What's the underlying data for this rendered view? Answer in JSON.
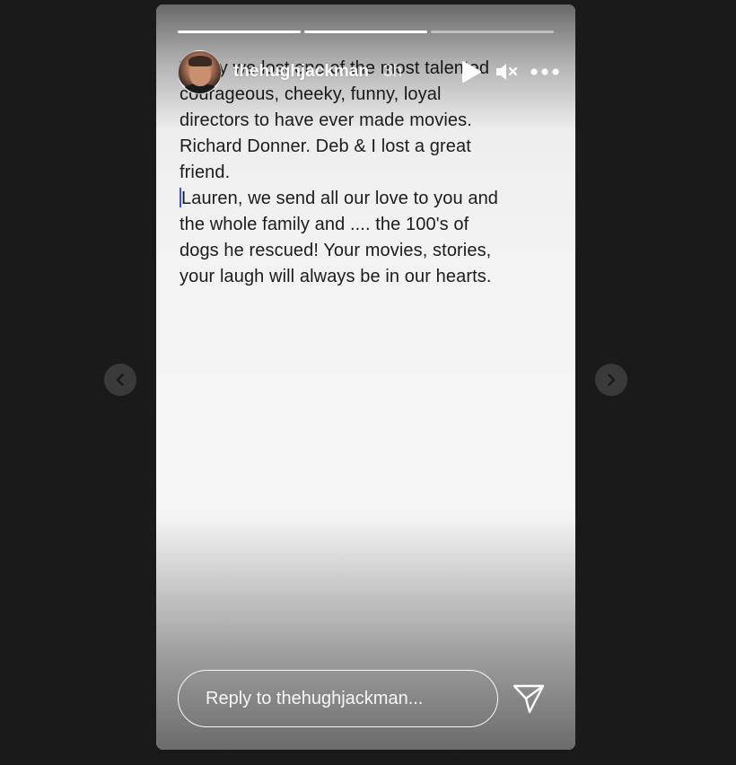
{
  "story": {
    "progress_segments": [
      {
        "fill_fraction": 1.0
      },
      {
        "fill_fraction": 1.0
      },
      {
        "fill_fraction": 0.0
      }
    ],
    "author": {
      "username": "thehughjackman",
      "time_ago": "3h"
    },
    "note_lines": [
      "Today we lost one of the most talented",
      "courageous, cheeky, funny, loyal",
      "directors to have ever made movies.",
      "Richard Donner. Deb & I lost a great",
      "friend.",
      "Lauren, we send all our love to you and",
      "the whole family and  .... the 100's of",
      "dogs he rescued! Your movies, stories,",
      "your laugh will always be in our hearts."
    ],
    "controls": {
      "play_icon": "play-icon",
      "mute_icon": "muted-speaker-icon",
      "more_icon": "more-options-icon"
    },
    "reply": {
      "placeholder": "Reply to thehughjackman...",
      "value": "",
      "send_icon": "paper-plane-icon"
    }
  },
  "navigation": {
    "prev_icon": "chevron-left-icon",
    "next_icon": "chevron-right-icon"
  },
  "colors": {
    "page_background": "#1a1a1a",
    "nav_button": "#3a3a3a",
    "caret": "#3a55d6"
  }
}
